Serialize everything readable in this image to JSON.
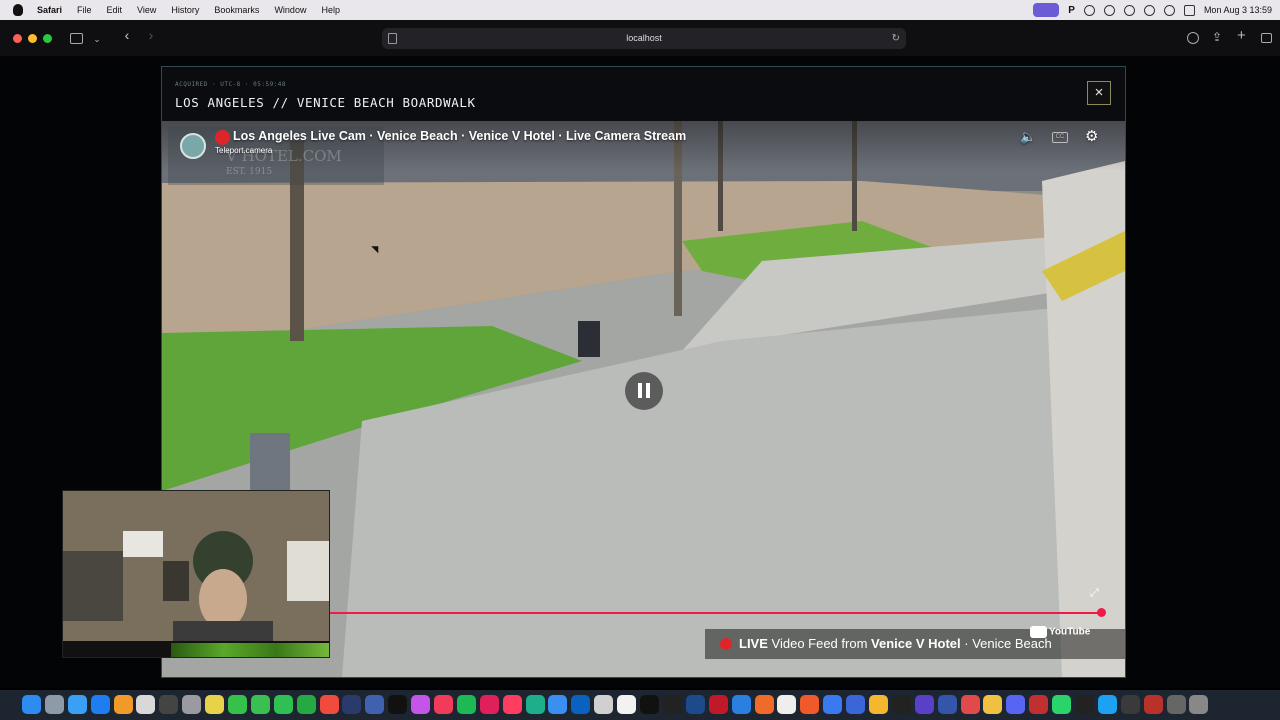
{
  "menubar": {
    "app_name": "Safari",
    "menus": [
      "File",
      "Edit",
      "View",
      "History",
      "Bookmarks",
      "Window",
      "Help"
    ],
    "status_icons": [
      "screen-record-icon",
      "p-icon",
      "vpn-icon",
      "sync-icon",
      "play-icon",
      "wifi-icon",
      "search-icon",
      "control-center-icon"
    ],
    "datetime": "Mon Aug 3  13:59"
  },
  "browser": {
    "url": "localhost"
  },
  "panel": {
    "meta": "ACQUIRED · UTC-8 · 05:59:48",
    "title": "LOS ANGELES // VENICE BEACH BOARDWALK",
    "close_label": "×"
  },
  "video": {
    "title": "Los Angeles Live Cam · Venice Beach · Venice V Hotel · Live Camera Stream",
    "subtitle": "Teleport.camera",
    "watermark": "V HOTEL.COM",
    "watermark_sub": "EST. 1915",
    "cc_label": "CC",
    "progress": 1.0,
    "live_label": "LIVE",
    "feed_prefix": "Video Feed from",
    "feed_source": "Venice V Hotel",
    "feed_suffix": "· Venice Beach",
    "youtube_label": "YouTube"
  },
  "dock": {
    "colors": [
      "#2d8cf0",
      "#8f9aa8",
      "#3aa0f5",
      "#1e7df0",
      "#f09a2a",
      "#d8d8d8",
      "#444",
      "#9a9aa0",
      "#e8d24a",
      "#36c24a",
      "#3ac050",
      "#2fbf52",
      "#26a843",
      "#f04b3c",
      "#2a3a6a",
      "#4060b0",
      "#111",
      "#c455e8",
      "#f03b5a",
      "#1db954",
      "#e0205a",
      "#ff3d5e",
      "#1fae8a",
      "#3b8ff0",
      "#0a62c0",
      "#d0d0d0",
      "#f2f2f2",
      "#111",
      "#222",
      "#1c4a8a",
      "#c01a2a",
      "#2a80e0",
      "#f06a2a",
      "#eee",
      "#f05a2a",
      "#3a7af0",
      "#3b66d8",
      "#f4b830",
      "#222",
      "#5a3fc8",
      "#3355aa",
      "#e04a4a",
      "#f0c040",
      "#5865f2",
      "#c03030",
      "#2bd46a",
      "#222",
      "#1da1f2",
      "#3a3a3a",
      "#b8322a",
      "#666",
      "#888"
    ]
  }
}
